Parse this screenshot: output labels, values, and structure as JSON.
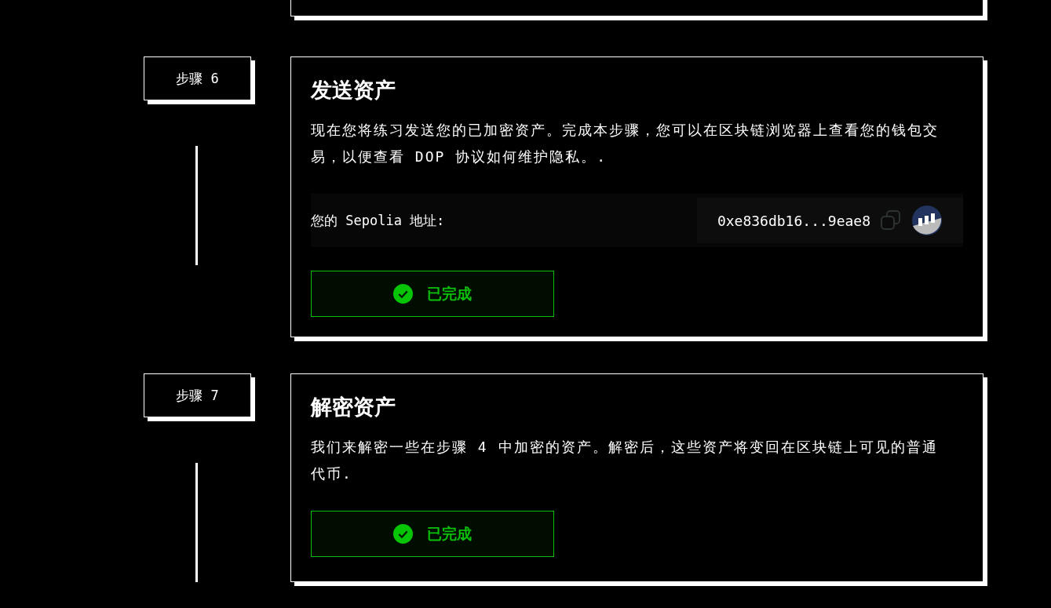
{
  "steps": [
    {
      "label": "步骤 6",
      "title": "发送资产",
      "description": "现在您将练习发送您的已加密资产。完成本步骤，您可以在区块链浏览器上查看您的钱包交易，以便查看 DOP 协议如何维护隐私。.",
      "address": {
        "label": "您的 Sepolia 地址:",
        "value": "0xe836db16...9eae8"
      },
      "button": {
        "label": "已完成",
        "completed": true
      }
    },
    {
      "label": "步骤 7",
      "title": "解密资产",
      "description": "我们来解密一些在步骤 4 中加密的资产。解密后，这些资产将变回在区块链上可见的普通代币.",
      "button": {
        "label": "已完成",
        "completed": true
      }
    }
  ]
}
